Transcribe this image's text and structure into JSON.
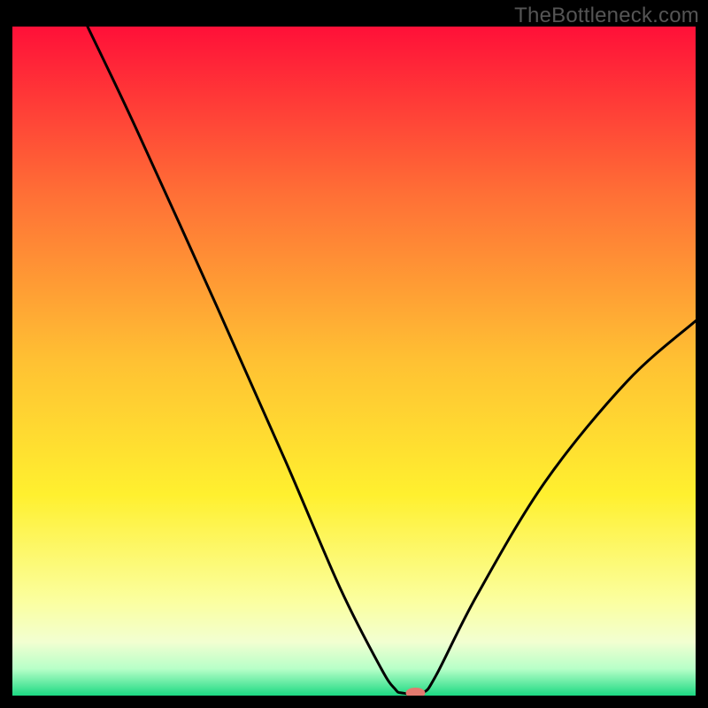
{
  "watermark": "TheBottleneck.com",
  "chart_data": {
    "type": "line",
    "title": "",
    "xlabel": "",
    "ylabel": "",
    "xlim": [
      0,
      100
    ],
    "ylim": [
      0,
      100
    ],
    "grid": false,
    "series": [
      {
        "name": "curve",
        "points": [
          {
            "x": 11,
            "y": 100
          },
          {
            "x": 18,
            "y": 85
          },
          {
            "x": 30,
            "y": 58
          },
          {
            "x": 40,
            "y": 35
          },
          {
            "x": 48,
            "y": 16
          },
          {
            "x": 54,
            "y": 4
          },
          {
            "x": 56,
            "y": 1
          },
          {
            "x": 57,
            "y": 0.4
          },
          {
            "x": 60,
            "y": 0.4
          },
          {
            "x": 62,
            "y": 3
          },
          {
            "x": 68,
            "y": 15
          },
          {
            "x": 78,
            "y": 32
          },
          {
            "x": 90,
            "y": 47
          },
          {
            "x": 100,
            "y": 56
          }
        ]
      }
    ],
    "marker": {
      "x": 59,
      "y": 0.4
    },
    "background": {
      "type": "vertical-gradient",
      "stops": [
        {
          "pos": 0.0,
          "color": "#ff1038"
        },
        {
          "pos": 0.25,
          "color": "#ff6f36"
        },
        {
          "pos": 0.5,
          "color": "#ffc133"
        },
        {
          "pos": 0.7,
          "color": "#fff02f"
        },
        {
          "pos": 0.86,
          "color": "#fbffa0"
        },
        {
          "pos": 0.92,
          "color": "#f2ffd1"
        },
        {
          "pos": 0.96,
          "color": "#b7ffc8"
        },
        {
          "pos": 1.0,
          "color": "#1cd982"
        }
      ]
    }
  }
}
